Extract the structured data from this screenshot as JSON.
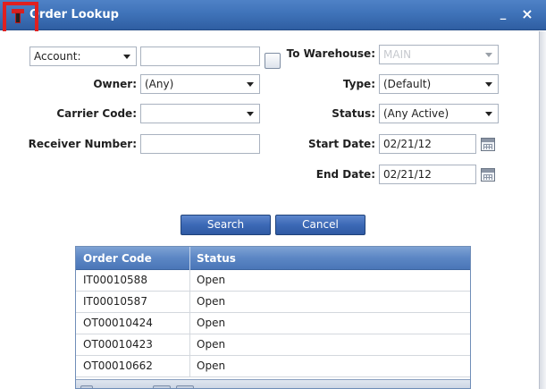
{
  "window": {
    "title": "Order Lookup",
    "minimize_glyph": "_",
    "close_glyph": "×"
  },
  "form": {
    "account_select": "Account:",
    "account_value": "",
    "owner_label": "Owner:",
    "owner_value": "(Any)",
    "carrier_label": "Carrier Code:",
    "carrier_value": "",
    "receiver_label": "Receiver Number:",
    "receiver_value": "",
    "warehouse_label": "To Warehouse:",
    "warehouse_value": "MAIN",
    "type_label": "Type:",
    "type_value": "(Default)",
    "status_label": "Status:",
    "status_value": "(Any Active)",
    "start_label": "Start Date:",
    "start_value": "02/21/12",
    "end_label": "End Date:",
    "end_value": "02/21/12"
  },
  "buttons": {
    "search": "Search",
    "cancel": "Cancel"
  },
  "grid": {
    "columns": [
      "Order Code",
      "Status"
    ],
    "rows": [
      {
        "code": "IT00010588",
        "status": "Open"
      },
      {
        "code": "IT00010587",
        "status": "Open"
      },
      {
        "code": "OT00010424",
        "status": "Open"
      },
      {
        "code": "OT00010423",
        "status": "Open"
      },
      {
        "code": "OT00010662",
        "status": "Open"
      }
    ]
  },
  "colors": {
    "titlebar": "#3f73b9",
    "button": "#3c69b6",
    "grid_header": "#5b86c4",
    "highlight": "#e02020"
  },
  "icons": [
    "app-logo-icon",
    "calendar-icon",
    "chevron-down-icon"
  ]
}
